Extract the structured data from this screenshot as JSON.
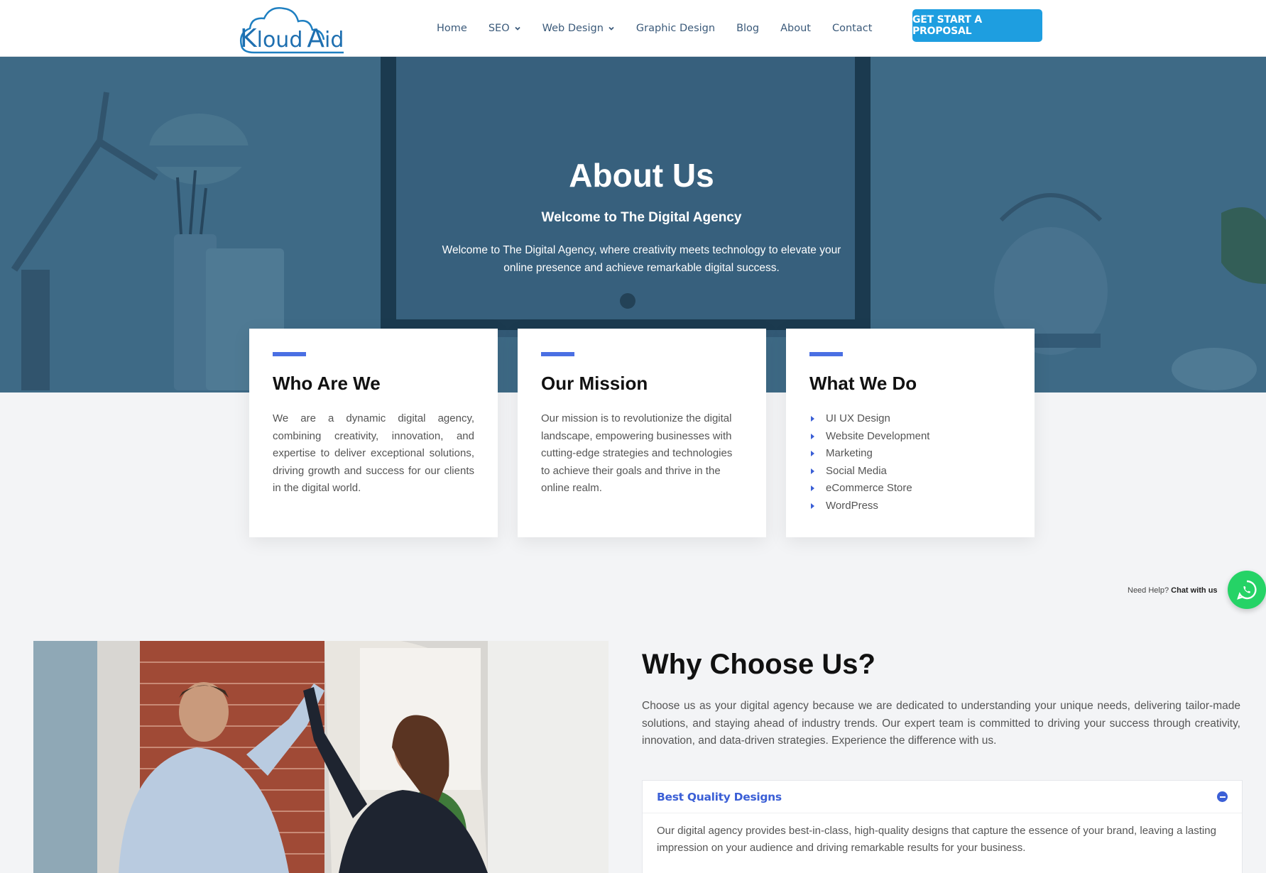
{
  "header": {
    "logo_text_k": "K",
    "logo_text_loud": "loud",
    "logo_text_a": "A",
    "logo_text_id": "id",
    "nav": [
      {
        "label": "Home",
        "has_dropdown": false
      },
      {
        "label": "SEO",
        "has_dropdown": true
      },
      {
        "label": "Web Design",
        "has_dropdown": true
      },
      {
        "label": "Graphic Design",
        "has_dropdown": false
      },
      {
        "label": "Blog",
        "has_dropdown": false
      },
      {
        "label": "About",
        "has_dropdown": false
      },
      {
        "label": "Contact",
        "has_dropdown": false
      }
    ],
    "cta_label": "GET START A PROPOSAL"
  },
  "hero": {
    "title": "About Us",
    "subtitle": "Welcome to The Digital Agency",
    "description": "Welcome to The Digital Agency, where creativity meets technology to elevate your online presence and achieve remarkable digital success."
  },
  "cards": [
    {
      "title": "Who Are We",
      "text": "We are a dynamic digital agency, combining creativity, innovation, and expertise to deliver exceptional solutions, driving growth and success for our clients in the digital world."
    },
    {
      "title": "Our Mission",
      "text": "Our mission is to revolutionize the digital landscape, empowering businesses with cutting-edge strategies and technologies to achieve their goals and thrive in the online realm."
    },
    {
      "title": "What We Do",
      "items": [
        "UI UX Design",
        "Website Development",
        "Marketing",
        "Social Media",
        "eCommerce Store",
        "WordPress"
      ]
    }
  ],
  "chat": {
    "prefix": "Need Help?",
    "label": "Chat with us"
  },
  "why": {
    "title": "Why Choose Us?",
    "description": "Choose us as your digital agency because we are dedicated to understanding your unique needs, delivering tailor-made solutions, and staying ahead of industry trends. Our expert team is committed to driving your success through creativity, innovation, and data-driven strategies. Experience the difference with us.",
    "accordion": [
      {
        "title": "Best Quality Designs",
        "body": "Our digital agency provides best-in-class, high-quality designs that capture the essence of your brand, leaving a lasting impression on your audience and driving remarkable results for your business."
      }
    ]
  },
  "colors": {
    "accent": "#4a6fe3",
    "cta": "#1e9ee0",
    "hero_overlay": "#3e6a86",
    "whatsapp": "#25d366"
  },
  "icons": [
    "cloud-logo-icon",
    "chevron-down-icon",
    "caret-right-icon",
    "whatsapp-icon",
    "minus-circle-icon"
  ]
}
